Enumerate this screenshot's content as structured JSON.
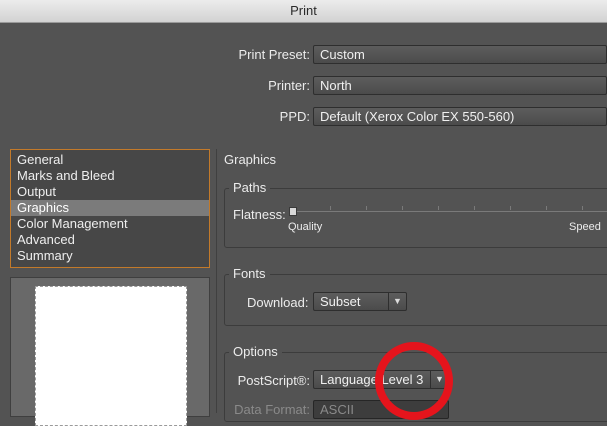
{
  "window": {
    "title": "Print"
  },
  "top": {
    "preset_label": "Print Preset:",
    "preset_value": "Custom",
    "printer_label": "Printer:",
    "printer_value": "North",
    "ppd_label": "PPD:",
    "ppd_value": "Default (Xerox Color EX 550-560)"
  },
  "sidebar": {
    "items": [
      {
        "label": "General"
      },
      {
        "label": "Marks and Bleed"
      },
      {
        "label": "Output"
      },
      {
        "label": "Graphics"
      },
      {
        "label": "Color Management"
      },
      {
        "label": "Advanced"
      },
      {
        "label": "Summary"
      }
    ],
    "selected": "Graphics"
  },
  "graphics": {
    "title": "Graphics",
    "paths": {
      "title": "Paths",
      "flatness_label": "Flatness:",
      "quality_label": "Quality",
      "speed_label": "Speed",
      "flatness_value": 0
    },
    "fonts": {
      "title": "Fonts",
      "download_label": "Download:",
      "download_value": "Subset"
    },
    "options": {
      "title": "Options",
      "postscript_label": "PostScript®:",
      "postscript_value": "Language Level 3",
      "data_format_label": "Data Format:",
      "data_format_value": "ASCII"
    }
  },
  "annotation": {
    "color": "#e5141c"
  },
  "icons": {
    "dropdown": "chevron-down-icon"
  }
}
